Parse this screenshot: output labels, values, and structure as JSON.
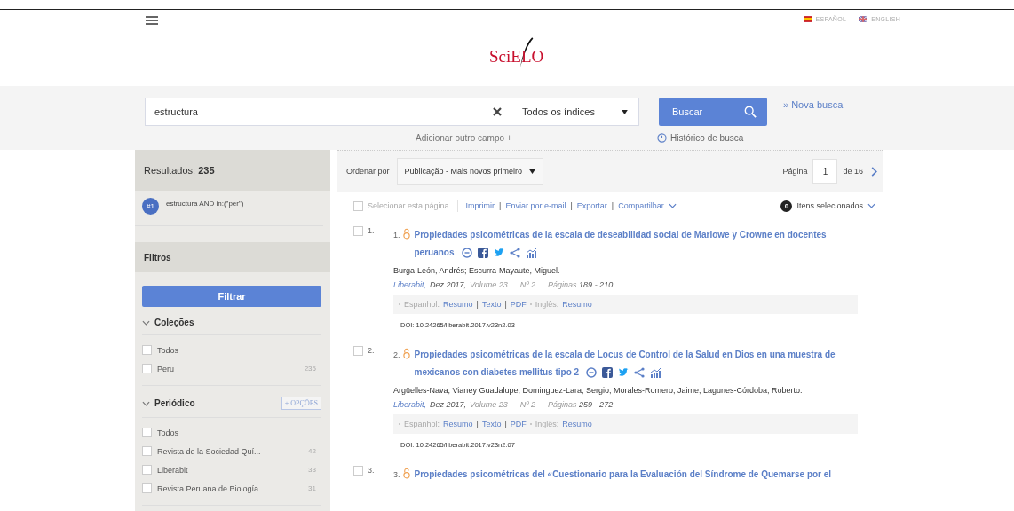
{
  "header": {
    "logo": "SciELO",
    "languages": [
      {
        "label": "ESPAÑOL",
        "kind": "es"
      },
      {
        "label": "ENGLISH",
        "kind": "gb"
      }
    ]
  },
  "search": {
    "value": "estructura",
    "index": "Todos os índices",
    "button": "Buscar",
    "new_search": "» Nova busca",
    "add_field": "Adicionar outro campo +",
    "history": "Histórico de busca"
  },
  "sidebar": {
    "results_label": "Resultados:",
    "results_count": "235",
    "query": {
      "badge": "#1",
      "text": "estructura AND in:(\"per\")"
    },
    "filters_title": "Filtros",
    "filter_button": "Filtrar",
    "groups": [
      {
        "title": "Coleções",
        "expanded": true,
        "items": [
          {
            "label": "Todos",
            "checked": false
          },
          {
            "label": "Peru",
            "count": "235",
            "checked": false
          }
        ]
      },
      {
        "title": "Periódico",
        "expanded": true,
        "options": "+ OPÇÕES",
        "items": [
          {
            "label": "Todos",
            "checked": false
          },
          {
            "label": "Revista de la Sociedad Quí...",
            "count": "42",
            "checked": false
          },
          {
            "label": "Liberabit",
            "count": "33",
            "checked": false
          },
          {
            "label": "Revista Peruana de Biología",
            "count": "31",
            "checked": false
          }
        ]
      }
    ]
  },
  "toolbar": {
    "sort_label": "Ordenar por",
    "sort": "Publicação - Mais novos primeiro",
    "page_label": "Página",
    "page": "1",
    "page_total": "de 16"
  },
  "actions": {
    "select_page": "Selecionar esta página",
    "select_checked": false,
    "links": [
      "Imprimir",
      "Enviar por e-mail",
      "Exportar",
      "Compartilhar"
    ],
    "separator": "|",
    "selected_count": "0",
    "selected_label": "Itens selecionados"
  },
  "results": [
    {
      "index": "1.",
      "number": "1.",
      "checked": false,
      "title": "Propiedades psicométricas de la escala de deseabilidad social de Marlowe y Crowne en docentes peruanos",
      "authors": "Burga-León, Andrés; Escurra-Mayaute, Miguel.",
      "journal": "Liberabit,",
      "date": "Dez 2017,",
      "volume": "Volume 23",
      "issue": "Nº 2",
      "pages_label": "Páginas",
      "pages": "189 - 210",
      "languages": [
        {
          "label": "Espanhol:",
          "links": [
            "Resumo",
            "Texto",
            "PDF"
          ]
        },
        {
          "label": "Inglês:",
          "links": [
            "Resumo"
          ]
        }
      ],
      "doi": "DOI: 10.24265/liberabit.2017.v23n2.03"
    },
    {
      "index": "2.",
      "number": "2.",
      "checked": false,
      "title": "Propiedades psicométricas de la escala de Locus de Control de la Salud en Dios en una muestra de mexicanos con diabetes mellitus tipo 2",
      "authors": "Argüelles-Nava, Vianey Guadalupe; Dominguez-Lara, Sergio; Morales-Romero, Jaime; Lagunes-Córdoba, Roberto.",
      "journal": "Liberabit,",
      "date": "Dez 2017,",
      "volume": "Volume 23",
      "issue": "Nº 2",
      "pages_label": "Páginas",
      "pages": "259 - 272",
      "languages": [
        {
          "label": "Espanhol:",
          "links": [
            "Resumo",
            "Texto",
            "PDF"
          ]
        },
        {
          "label": "Inglês:",
          "links": [
            "Resumo"
          ]
        }
      ],
      "doi": "DOI: 10.24265/liberabit.2017.v23n2.07"
    },
    {
      "index": "3.",
      "number": "3.",
      "checked": false,
      "title": "Propiedades psicométricas del «Cuestionario para la Evaluación del Síndrome de Quemarse por el"
    }
  ]
}
